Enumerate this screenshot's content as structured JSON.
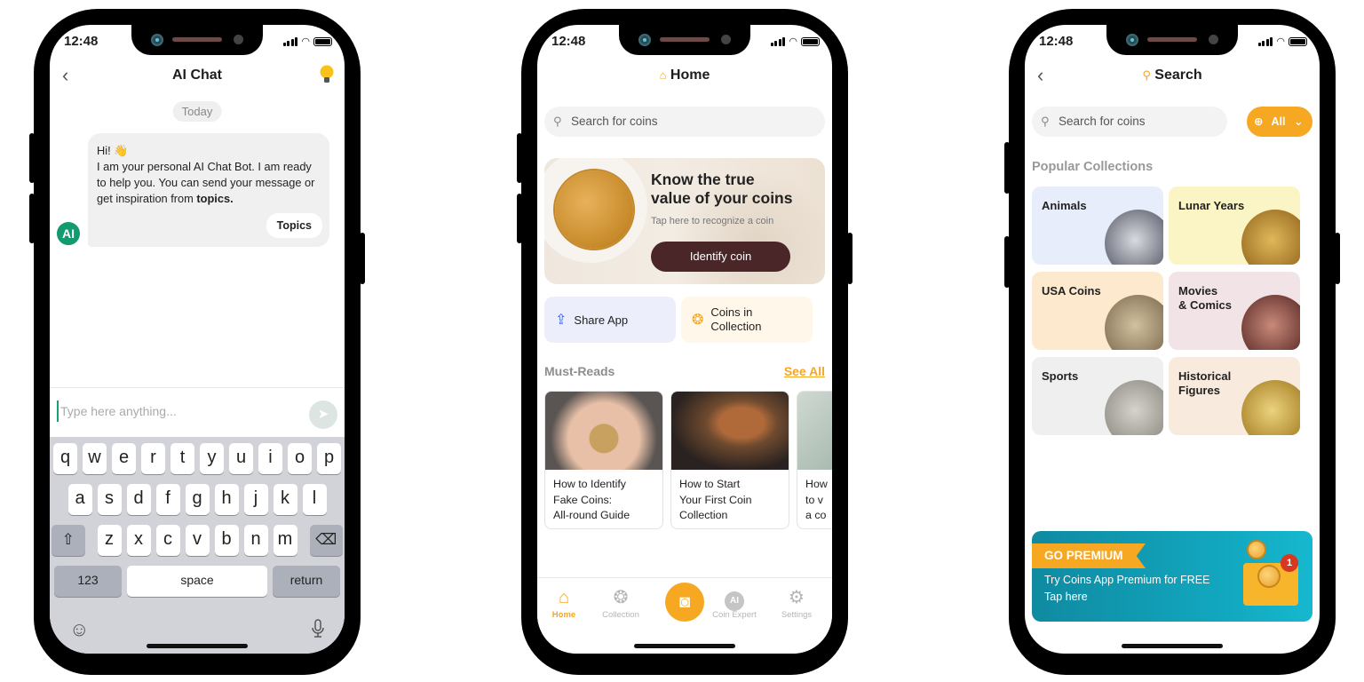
{
  "status_bar": {
    "time": "12:48"
  },
  "chat_screen": {
    "title": "AI Chat",
    "back_icon": "chevron-left",
    "hint_icon": "lightbulb",
    "date_chip": "Today",
    "message": {
      "greeting": "Hi! 👋",
      "body": "I am your personal AI Chat Bot. I am ready to help you. You can send your message or get inspiration from ",
      "bold_tail": "topics.",
      "topics_button": "Topics"
    },
    "avatar_label": "AI",
    "input_placeholder": "Type here anything...",
    "keyboard": {
      "row1": [
        "q",
        "w",
        "e",
        "r",
        "t",
        "y",
        "u",
        "i",
        "o",
        "p"
      ],
      "row2": [
        "a",
        "s",
        "d",
        "f",
        "g",
        "h",
        "j",
        "k",
        "l"
      ],
      "row3": [
        "z",
        "x",
        "c",
        "v",
        "b",
        "n",
        "m"
      ],
      "shift": "⇧",
      "delete": "⌫",
      "numbers": "123",
      "space": "space",
      "return": "return",
      "emoji_icon": "☺",
      "mic_icon": "🎙"
    }
  },
  "home_screen": {
    "title": "Home",
    "search_placeholder": "Search for coins",
    "hero": {
      "title_line1": "Know the true",
      "title_line2": "value of your coins",
      "subtitle": "Tap here to recognize a coin",
      "button": "Identify coin"
    },
    "quick_actions": [
      {
        "label": "Share App",
        "icon": "share"
      },
      {
        "label": "Coins in Collection",
        "icon": "coins"
      }
    ],
    "must_reads": {
      "title": "Must-Reads",
      "see_all": "See All",
      "articles": [
        {
          "line1": "How to Identify",
          "line2": "Fake Coins:",
          "line3": "All-round Guide"
        },
        {
          "line1": "How to Start",
          "line2": "Your First Coin",
          "line3": "Collection"
        },
        {
          "line1": "How",
          "line2": "to v",
          "line3": "a co"
        }
      ]
    },
    "tabbar": [
      {
        "label": "Home",
        "icon": "house",
        "active": true
      },
      {
        "label": "Collection",
        "icon": "coins"
      },
      {
        "label": "",
        "icon": "camera"
      },
      {
        "label": "Coin Expert",
        "icon": "ai-badge"
      },
      {
        "label": "Settings",
        "icon": "gear"
      }
    ],
    "accent_color": "#f5a623"
  },
  "search_screen": {
    "title": "Search",
    "search_placeholder": "Search for coins",
    "filter_label": "All",
    "section_title": "Popular Collections",
    "collections": [
      {
        "name": "Animals",
        "bg": "#e8edfb"
      },
      {
        "name": "Lunar Years",
        "bg": "#fbf4c4"
      },
      {
        "name": "USA Coins",
        "bg": "#fde9cd"
      },
      {
        "name": "Movies & Comics",
        "bg": "#f2e4e6"
      },
      {
        "name": "Sports",
        "bg": "#efefef"
      },
      {
        "name": "Historical Figures",
        "bg": "#f8ebdd"
      }
    ],
    "premium": {
      "ribbon": "GO PREMIUM",
      "line1": "Try Coins App Premium for FREE",
      "line2": "Tap here",
      "badge": "1"
    }
  }
}
